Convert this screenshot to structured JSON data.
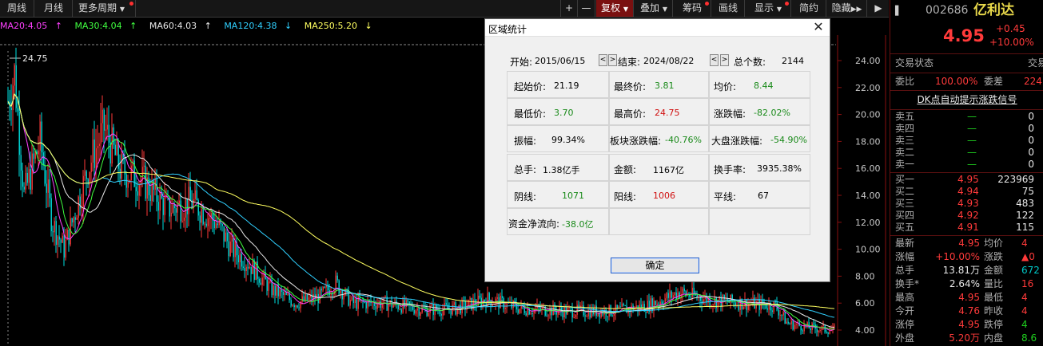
{
  "toolbar": {
    "weekly": "周线",
    "monthly": "月线",
    "more_periods": "更多周期",
    "plus": "+",
    "minus": "—",
    "adjust": "复权",
    "overlay": "叠加",
    "chips": "筹码",
    "draw": "画线",
    "display": "显示",
    "simple": "简约",
    "hide": "隐藏"
  },
  "ma": {
    "ma20": "MA20:4.05",
    "ma30": "MA30:4.04",
    "ma60": "MA60:4.03",
    "ma120": "MA120:4.38",
    "ma250": "MA250:5.20"
  },
  "chart": {
    "high_label": "24.75",
    "y_ticks": [
      "24.00",
      "22.00",
      "20.00",
      "18.00",
      "16.00",
      "14.00",
      "12.00",
      "10.00",
      "8.00",
      "6.00",
      "4.00"
    ]
  },
  "dialog": {
    "title": "区域统计",
    "start_label": "开始:",
    "start_value": "2015/06/15",
    "end_label": "结束:",
    "end_value": "2024/08/22",
    "count_label": "总个数:",
    "count_value": "2144",
    "open_label": "起始价:",
    "open_value": "21.19",
    "close_label": "最终价:",
    "close_value": "3.81",
    "avg_label": "均价:",
    "avg_value": "8.44",
    "low_label": "最低价:",
    "low_value": "3.70",
    "high_label": "最高价:",
    "high_value": "24.75",
    "chg_label": "涨跌幅:",
    "chg_value": "-82.02%",
    "amp_label": "振幅:",
    "amp_value": "99.34%",
    "sector_label": "板块涨跌幅:",
    "sector_value": "-40.76%",
    "market_label": "大盘涨跌幅:",
    "market_value": "-54.90%",
    "vol_label": "总手:",
    "vol_value": "1.38亿手",
    "amt_label": "金额:",
    "amt_value": "1167亿",
    "turn_label": "换手率:",
    "turn_value": "3935.38%",
    "yin_label": "阴线:",
    "yin_value": "1071",
    "yang_label": "阳线:",
    "yang_value": "1006",
    "flat_label": "平线:",
    "flat_value": "67",
    "flow_label": "资金净流向:",
    "flow_value": "-38.0亿",
    "ok": "确定",
    "prev": "<",
    "next": ">",
    "close": "✕"
  },
  "quote": {
    "code": "002686",
    "name": "亿利达",
    "price": "4.95",
    "change": "+0.45",
    "pct": "+10.00%",
    "status_label": "交易状态",
    "status_right": "交易",
    "weibi_label": "委比",
    "weibi_value": "100.00%",
    "weicha_label": "委差",
    "weicha_value": "224",
    "signal": "DK点自动提示涨跌信号",
    "asks": [
      {
        "label": "卖五",
        "price": "—",
        "vol": "0"
      },
      {
        "label": "卖四",
        "price": "—",
        "vol": "0"
      },
      {
        "label": "卖三",
        "price": "—",
        "vol": "0"
      },
      {
        "label": "卖二",
        "price": "—",
        "vol": "0"
      },
      {
        "label": "卖一",
        "price": "—",
        "vol": "0"
      }
    ],
    "bids": [
      {
        "label": "买一",
        "price": "4.95",
        "vol": "223969"
      },
      {
        "label": "买二",
        "price": "4.94",
        "vol": "75"
      },
      {
        "label": "买三",
        "price": "4.93",
        "vol": "483"
      },
      {
        "label": "买四",
        "price": "4.92",
        "vol": "122"
      },
      {
        "label": "买五",
        "price": "4.91",
        "vol": "115"
      }
    ],
    "stats": [
      {
        "l1": "最新",
        "v1": "4.95",
        "l2": "均价",
        "v2": "4"
      },
      {
        "l1": "涨幅",
        "v1": "+10.00%",
        "l2": "涨跌",
        "v2": "▲0"
      },
      {
        "l1": "总手",
        "v1": "13.81万",
        "l2": "金额",
        "v2": "672"
      },
      {
        "l1": "换手*",
        "v1": "2.64%",
        "l2": "量比",
        "v2": "16"
      },
      {
        "l1": "最高",
        "v1": "4.95",
        "l2": "最低",
        "v2": "4"
      },
      {
        "l1": "今开",
        "v1": "4.76",
        "l2": "昨收",
        "v2": "4"
      },
      {
        "l1": "涨停",
        "v1": "4.95",
        "l2": "跌停",
        "v2": "4"
      },
      {
        "l1": "外盘",
        "v1": "5.20万",
        "l2": "内盘",
        "v2": "8.6"
      }
    ]
  }
}
